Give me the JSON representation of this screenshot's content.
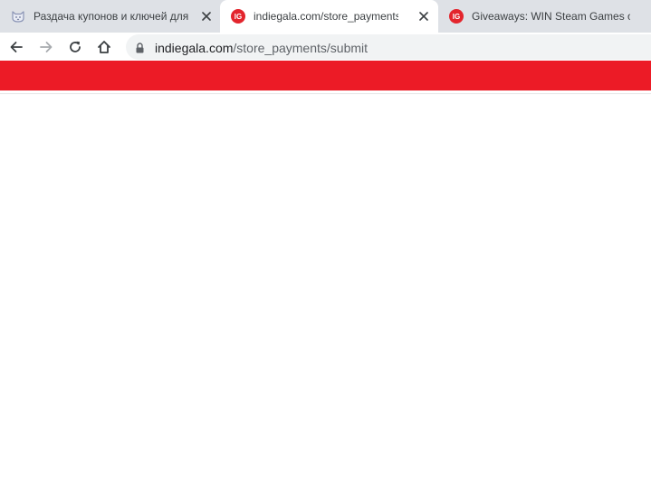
{
  "tabs": [
    {
      "title": "Раздача купонов и ключей для",
      "favicon": "cat-face-icon",
      "active": false
    },
    {
      "title": "indiegala.com/store_payments/su",
      "favicon": "indiegala-icon",
      "favicon_text": "IG",
      "active": true
    },
    {
      "title": "Giveaways: WIN Steam Games on",
      "favicon": "indiegala-icon",
      "favicon_text": "IG",
      "active": false
    }
  ],
  "toolbar": {
    "back": "back-arrow-icon",
    "forward": "forward-arrow-icon",
    "reload": "reload-icon",
    "home": "home-icon"
  },
  "omnibox": {
    "host": "indiegala.com",
    "path": "/store_payments/submit",
    "security": "lock-icon"
  },
  "colors": {
    "tab_strip": "#dee1e6",
    "banner": "#ec1b26",
    "favicon_red": "#e3252d"
  }
}
